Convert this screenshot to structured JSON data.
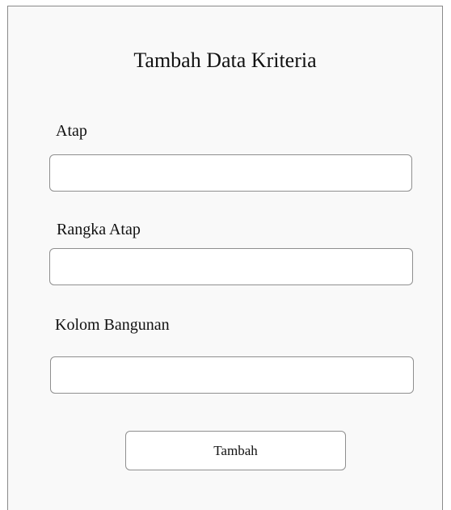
{
  "form": {
    "title": "Tambah Data Kriteria",
    "fields": [
      {
        "label": "Atap",
        "value": "",
        "placeholder": ""
      },
      {
        "label": "Rangka Atap",
        "value": "",
        "placeholder": ""
      },
      {
        "label": "Kolom Bangunan",
        "value": "",
        "placeholder": ""
      }
    ],
    "submit_label": "Tambah"
  }
}
